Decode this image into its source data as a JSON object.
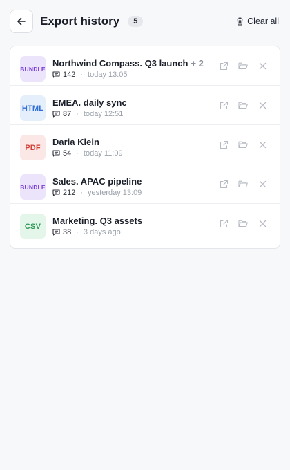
{
  "header": {
    "title": "Export history",
    "count": "5",
    "clear_label": "Clear all"
  },
  "exports": [
    {
      "type": "BUNDLE",
      "name": "Northwind Compass. Q3 launch",
      "extra": "+ 2",
      "messages": "142",
      "time": "today 13:05",
      "badge_bg": "#ece4fb",
      "badge_color": "#7a3fd6"
    },
    {
      "type": "HTML",
      "name": "EMEA. daily sync",
      "extra": "",
      "messages": "87",
      "time": "today 12:51",
      "badge_bg": "#e5eefb",
      "badge_color": "#2f6fd6"
    },
    {
      "type": "PDF",
      "name": "Daria Klein",
      "extra": "",
      "messages": "54",
      "time": "today 11:09",
      "badge_bg": "#fbe7e6",
      "badge_color": "#d23f36"
    },
    {
      "type": "BUNDLE",
      "name": "Sales. APAC pipeline",
      "extra": "",
      "messages": "212",
      "time": "yesterday 13:09",
      "badge_bg": "#ece4fb",
      "badge_color": "#7a3fd6"
    },
    {
      "type": "CSV",
      "name": "Marketing. Q3 assets",
      "extra": "",
      "messages": "38",
      "time": "3 days ago",
      "badge_bg": "#e4f5ea",
      "badge_color": "#2e9a56"
    }
  ],
  "icons": {
    "back": "arrow-left-icon",
    "clear": "trash-icon",
    "message": "message-icon",
    "open": "external-link-icon",
    "folder": "folder-icon",
    "remove": "close-icon"
  }
}
